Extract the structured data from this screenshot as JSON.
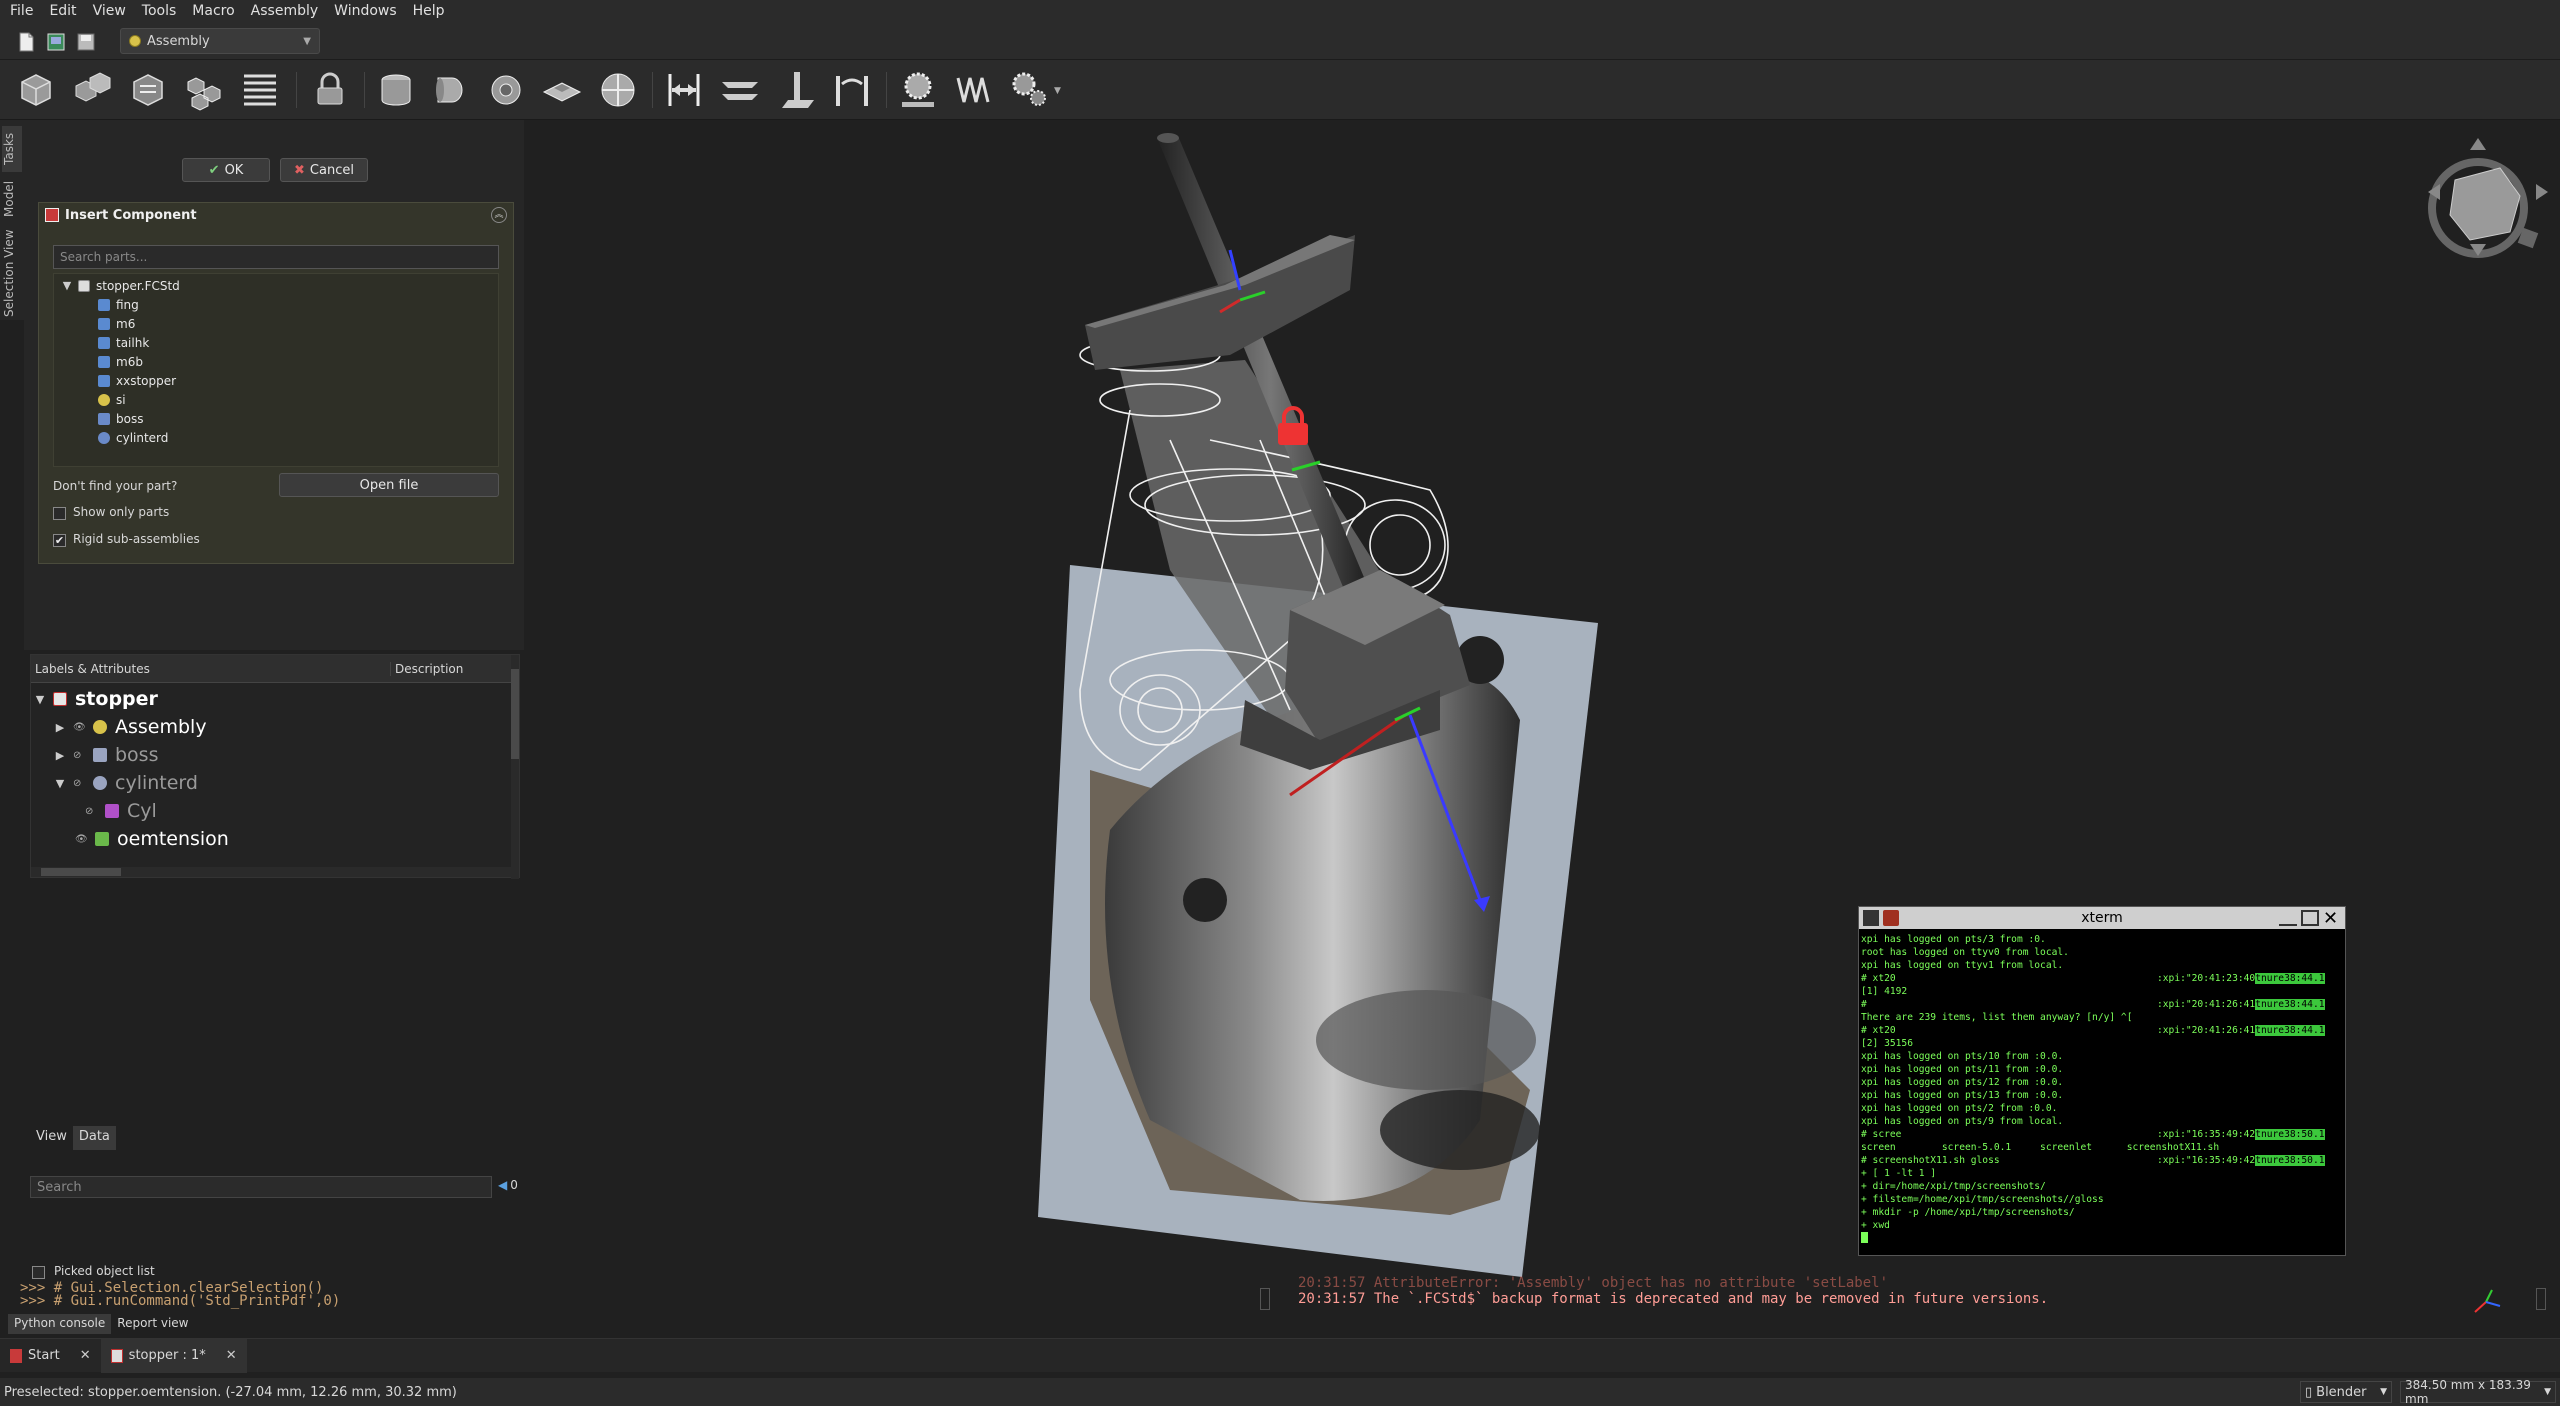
{
  "menu": [
    "File",
    "Edit",
    "View",
    "Tools",
    "Macro",
    "Assembly",
    "Windows",
    "Help"
  ],
  "workbench": "Assembly",
  "vertical_tabs": [
    "Tasks",
    "Model",
    "Selection View"
  ],
  "task": {
    "ok": "OK",
    "cancel": "Cancel",
    "panel_title": "Insert Component",
    "search_placeholder": "Search parts...",
    "root_file": "stopper.FCStd",
    "parts": [
      "fing",
      "m6",
      "tailhk",
      "m6b",
      "xxstopper",
      "si",
      "boss",
      "cylinterd"
    ],
    "dont_find": "Don't find your part?",
    "open_file": "Open file",
    "show_only_parts": "Show only parts",
    "show_only_parts_checked": false,
    "rigid_sub": "Rigid sub-assemblies",
    "rigid_sub_checked": true
  },
  "tree": {
    "col_labels": "Labels & Attributes",
    "col_description": "Description",
    "root": "stopper",
    "items": [
      "Assembly",
      "boss",
      "cylinterd",
      "Cyl",
      "oemtension"
    ]
  },
  "prop_tabs": [
    "View",
    "Data"
  ],
  "prop_search": "Search",
  "prop_count": "0",
  "picked_object_list": "Picked object list",
  "console_lines": [
    ">>> # Gui.Selection.clearSelection()",
    ">>> # Gui.runCommand('Std_PrintPdf',0)"
  ],
  "console_tabs": [
    "Python console",
    "Report view"
  ],
  "report_line": "20:31:57  The `.FCStd$` backup format is deprecated and may be removed in future versions.",
  "report_cut": "20:31:57  AttributeError: 'Assembly' object has no attribute 'setLabel'",
  "doc_tabs": [
    "Start",
    "stopper : 1*"
  ],
  "status": {
    "preselected": "Preselected: stopper.oemtension. (-27.04 mm, 12.26 mm, 30.32 mm)",
    "nav_style": "Blender",
    "dims": "384.50 mm x 183.39 mm"
  },
  "xterm": {
    "title": "xterm",
    "lines": [
      "xpi has logged on pts/3 from :0.",
      "root has logged on ttyv0 from local.",
      "xpi has logged on ttyv1 from local.",
      "# xt20",
      "[1] 4192",
      "#",
      "There are 239 items, list them anyway? [n/y] ^[",
      "# xt20",
      "[2] 35156",
      "xpi has logged on pts/10 from :0.0.",
      "xpi has logged on pts/11 from :0.0.",
      "xpi has logged on pts/12 from :0.0.",
      "xpi has logged on pts/13 from :0.0.",
      "xpi has logged on pts/2 from :0.0.",
      "xpi has logged on pts/9 from local.",
      "# scree",
      "screen        screen-5.0.1     screenlet      screenshotX11.sh",
      "# screenshotX11.sh gloss",
      "+ [ 1 -lt 1 ]",
      "+ dir=/home/xpi/tmp/screenshots/",
      "+ filstem=/home/xpi/tmp/screenshots//gloss",
      "+ mkdir -p /home/xpi/tmp/screenshots/",
      "+ xwd"
    ],
    "prompts": [
      ":xpi:\"20:41:23:40",
      ":xpi:\"20:41:26:41",
      ":xpi:\"20:41:26:41",
      ":xpi:\"16:35:49:42",
      ":xpi:\"16:35:49:42"
    ],
    "prompt_hl": [
      "tnure38:44.1",
      "tnure38:44.1",
      "tnure38:44.1",
      "tnure38:50.1",
      "tnure38:50.1"
    ]
  },
  "colors": {
    "panel_bg": "#34352a",
    "selection_blue": "#3a66b8",
    "console_text": "#d6a06a"
  }
}
